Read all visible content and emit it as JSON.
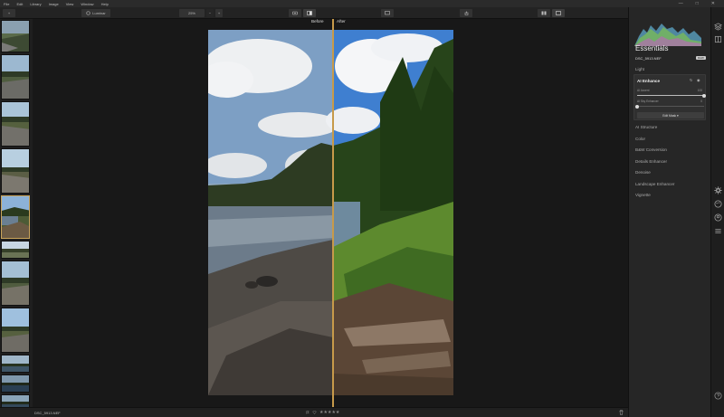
{
  "menu": [
    "File",
    "Edit",
    "Library",
    "Image",
    "View",
    "Window",
    "Help"
  ],
  "window_controls": [
    "—",
    "□",
    "✕"
  ],
  "toolbar": {
    "add_label": "+",
    "folder_label": "Luminar",
    "zoom_label": "25%",
    "zoom_minus": "−",
    "zoom_plus": "+",
    "tabs": [
      "Catalog",
      "Edit",
      "Info"
    ]
  },
  "canvas": {
    "before_label": "Before",
    "after_label": "After"
  },
  "panel": {
    "title": "Essentials",
    "file_name": "DSC_5913.NEF",
    "raw_tag": "RAW",
    "sections_top": [
      "Light"
    ],
    "ai_enhance": {
      "title": "AI Enhance",
      "sliders": [
        {
          "label": "AI Accent",
          "value": "100",
          "level": 1.0
        },
        {
          "label": "AI Sky Enhancer",
          "value": "0",
          "level": 0.0
        }
      ],
      "edit_mask_label": "Edit Mask ▾"
    },
    "sections": [
      "AI Structure",
      "Color",
      "B&W Conversion",
      "Details Enhancer",
      "Denoise",
      "Landscape Enhancer",
      "Vignette"
    ]
  },
  "statusbar": {
    "file_name": "DSC_5913.NEF",
    "flag_icons": [
      "flag-icon",
      "heart-icon"
    ],
    "stars": "★★★★★",
    "trash": "🗑"
  },
  "accent_color": "#c79a4a"
}
